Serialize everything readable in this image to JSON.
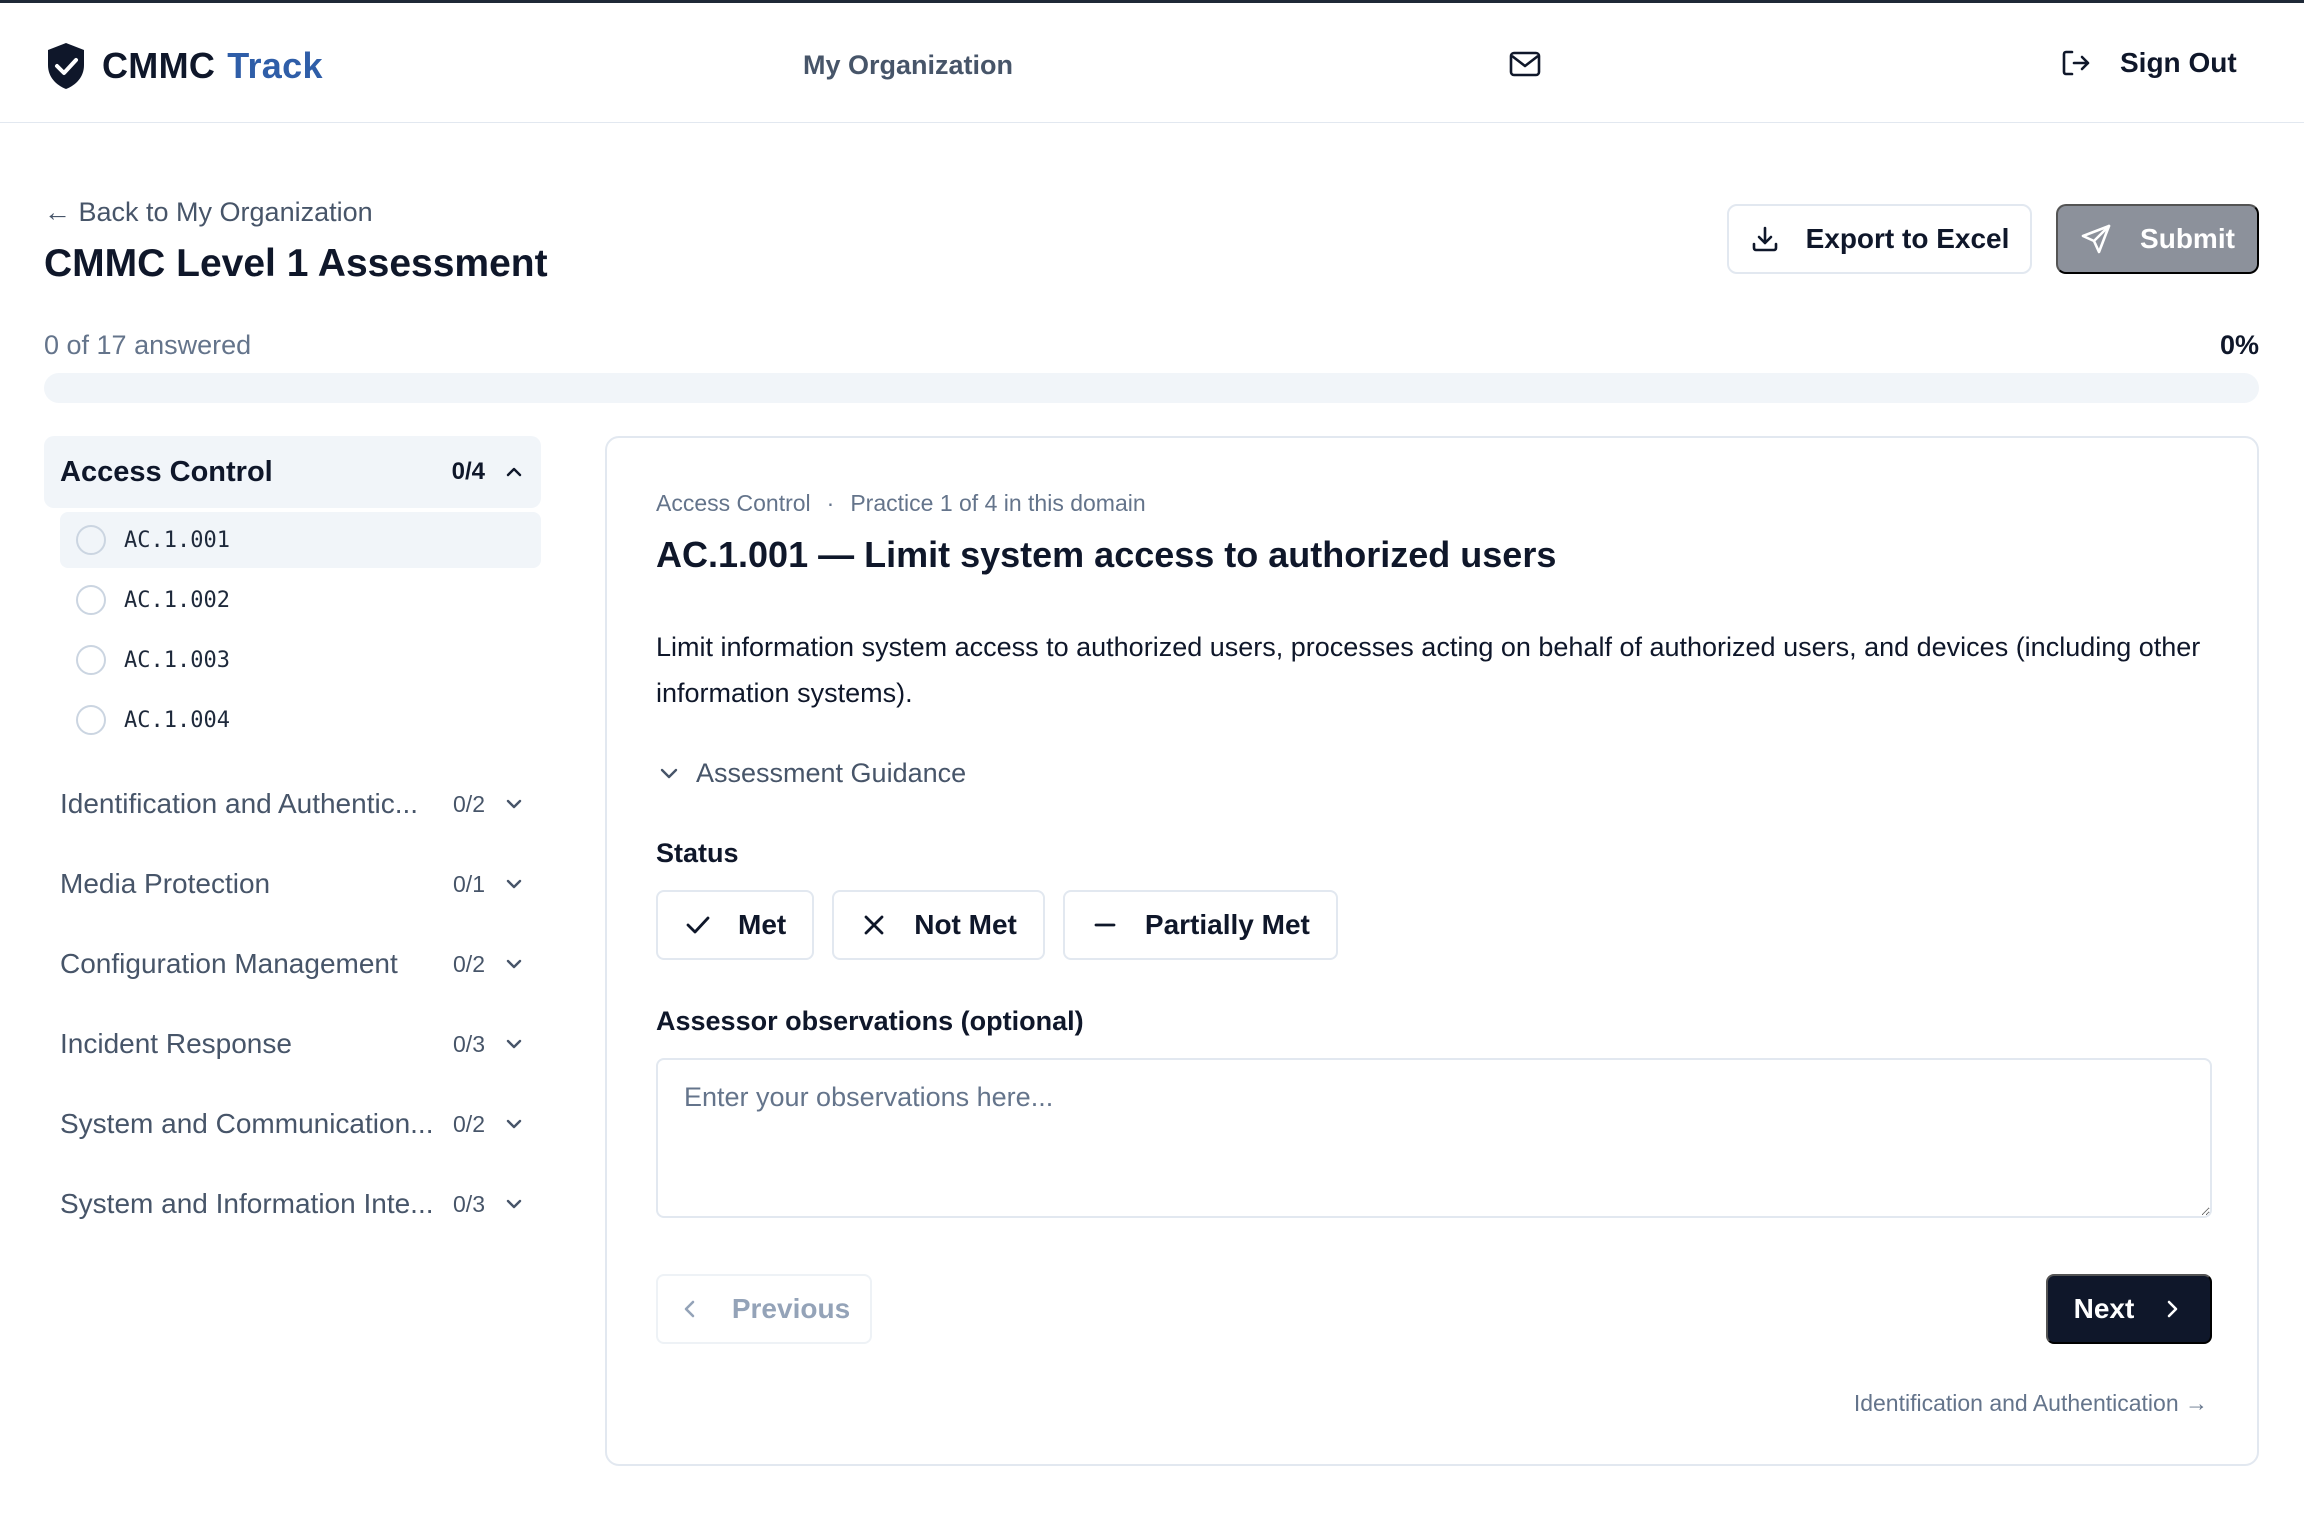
{
  "header": {
    "brand_primary": "CMMC",
    "brand_secondary": "Track",
    "nav_org": "My Organization",
    "mail_icon": "mail-icon",
    "sign_out": "Sign Out",
    "sign_out_icon": "log-out-icon"
  },
  "page": {
    "back_link": "← Back to My Organization",
    "title": "CMMC Level 1 Assessment",
    "export_label": "Export to Excel",
    "submit_label": "Submit",
    "progress_text": "0 of 17 answered",
    "progress_percent": "0%",
    "progress_value": 0
  },
  "sidebar": {
    "active_domain": {
      "name": "Access Control",
      "count": "0/4",
      "practices": [
        {
          "code": "AC.1.001",
          "active": true
        },
        {
          "code": "AC.1.002",
          "active": false
        },
        {
          "code": "AC.1.003",
          "active": false
        },
        {
          "code": "AC.1.004",
          "active": false
        }
      ]
    },
    "domains": [
      {
        "name": "Identification and Authentic...",
        "count": "0/2"
      },
      {
        "name": "Media Protection",
        "count": "0/1"
      },
      {
        "name": "Configuration Management",
        "count": "0/2"
      },
      {
        "name": "Incident Response",
        "count": "0/3"
      },
      {
        "name": "System and Communication...",
        "count": "0/2"
      },
      {
        "name": "System and Information Inte...",
        "count": "0/3"
      }
    ]
  },
  "main": {
    "crumb_domain": "Access Control",
    "crumb_sep": "·",
    "crumb_position": "Practice 1 of 4 in this domain",
    "title": "AC.1.001 — Limit system access to authorized users",
    "description": "Limit information system access to authorized users, processes acting on behalf of authorized users, and devices (including other information systems).",
    "guidance_label": "Assessment Guidance",
    "status_label": "Status",
    "status_options": {
      "met": "Met",
      "not_met": "Not Met",
      "partially_met": "Partially Met"
    },
    "observations_label": "Assessor observations (optional)",
    "observations_placeholder": "Enter your observations here...",
    "observations_value": "",
    "prev_label": "Previous",
    "next_label": "Next",
    "next_domain_link": "Identification and Authentication →"
  },
  "colors": {
    "brand_accent": "#2f5ea8",
    "primary_dark": "#0f172a",
    "submit_disabled": "#8c919b",
    "muted_text": "#475569",
    "border": "#e2e8f0",
    "surface": "#f1f5f9"
  }
}
